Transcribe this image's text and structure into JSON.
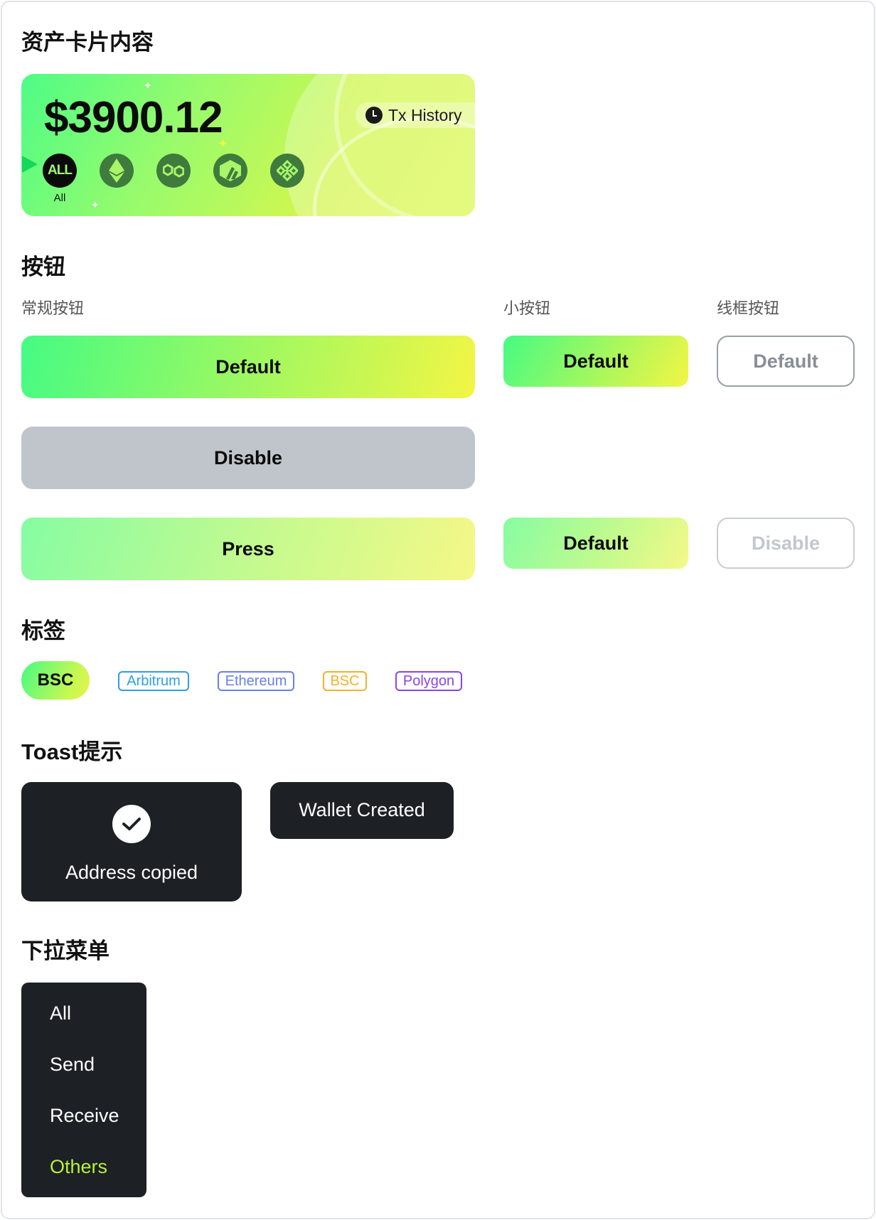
{
  "sections": {
    "asset_card": "资产卡片内容",
    "buttons": "按钮",
    "tags": "标签",
    "toast": "Toast提示",
    "dropdown": "下拉菜单"
  },
  "asset_card": {
    "balance": "$3900.12",
    "tx_history_label": "Tx History",
    "chains": [
      {
        "name": "all",
        "label": "ALL",
        "caption": "All",
        "icon": "all-chains-icon"
      },
      {
        "name": "ethereum",
        "icon": "ethereum-icon"
      },
      {
        "name": "polygon",
        "icon": "polygon-icon"
      },
      {
        "name": "arbitrum",
        "icon": "arbitrum-icon"
      },
      {
        "name": "bnb",
        "icon": "bnb-icon"
      }
    ]
  },
  "buttons": {
    "regular_label": "常规按钮",
    "small_label": "小按钮",
    "outline_label": "线框按钮",
    "default_label": "Default",
    "disable_label": "Disable",
    "press_label": "Press"
  },
  "tags": {
    "solid": "BSC",
    "outline": [
      {
        "label": "Arbitrum",
        "color": "#2f9ee0"
      },
      {
        "label": "Ethereum",
        "color": "#6a7fe2"
      },
      {
        "label": "BSC",
        "color": "#f3b12b"
      },
      {
        "label": "Polygon",
        "color": "#8a45e0"
      }
    ]
  },
  "toasts": {
    "copied": "Address copied",
    "created": "Wallet Created"
  },
  "dropdown": {
    "items": [
      "All",
      "Send",
      "Receive",
      "Others"
    ],
    "active_color": "#b6f23a"
  },
  "colors": {
    "gradient_start": "#45fb83",
    "gradient_end": "#f3f545",
    "dark": "#1d2024",
    "disabled": "#c0c5cc"
  }
}
